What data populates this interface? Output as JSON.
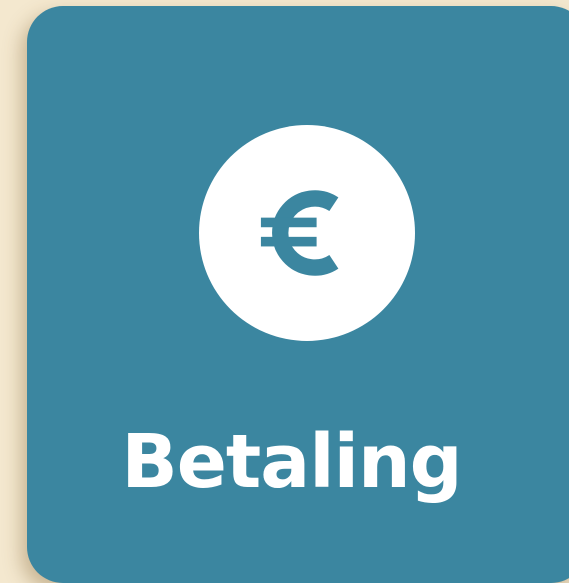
{
  "tile": {
    "label": "Betaling",
    "icon": "euro-icon",
    "background_color": "#3b86a0",
    "page_background_color": "#f4e8cf"
  }
}
